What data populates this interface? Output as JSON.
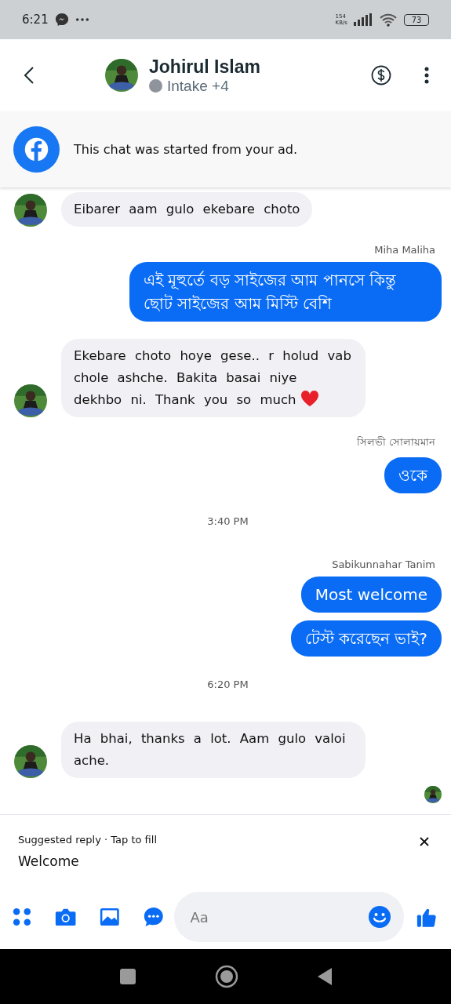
{
  "status_bar": {
    "time": "6:21",
    "speed": "154",
    "speed_unit": "KB/s",
    "battery": "73"
  },
  "header": {
    "name": "Johirul Islam",
    "status": "Intake +4"
  },
  "banner": {
    "text": "This chat was started from your ad."
  },
  "messages": [
    {
      "kind": "incoming",
      "text": "Eibarer aam gulo ekebare choto",
      "heart": false
    },
    {
      "kind": "sender",
      "text": "Miha Maliha"
    },
    {
      "kind": "outgoing",
      "text": "এই মূহুর্তে বড় সাইজের আম পানসে কিন্তু ছোট সাইজের আম মিস্টি বেশি"
    },
    {
      "kind": "incoming",
      "text": "Ekebare choto hoye gese.. r holud vab chole ashche. Bakita basai niye dekhbo ni. Thank you so much",
      "heart": true
    },
    {
      "kind": "sender",
      "text": "সিলভী সোলায়মান"
    },
    {
      "kind": "outgoing",
      "text": "ওকে"
    },
    {
      "kind": "time",
      "text": "3:40 PM"
    },
    {
      "kind": "sender",
      "text": "Sabikunnahar Tanim"
    },
    {
      "kind": "outgoing",
      "text": "Most welcome"
    },
    {
      "kind": "outgoing",
      "text": "টেস্ট করেছেন ভাই?"
    },
    {
      "kind": "time",
      "text": "6:20 PM"
    },
    {
      "kind": "incoming",
      "text": "Ha bhai, thanks a lot. Aam gulo valoi ache.",
      "heart": false
    },
    {
      "kind": "seen"
    }
  ],
  "suggested": {
    "label": "Suggested reply · Tap to fill",
    "reply": "Welcome"
  },
  "composer": {
    "placeholder": "Aa"
  }
}
